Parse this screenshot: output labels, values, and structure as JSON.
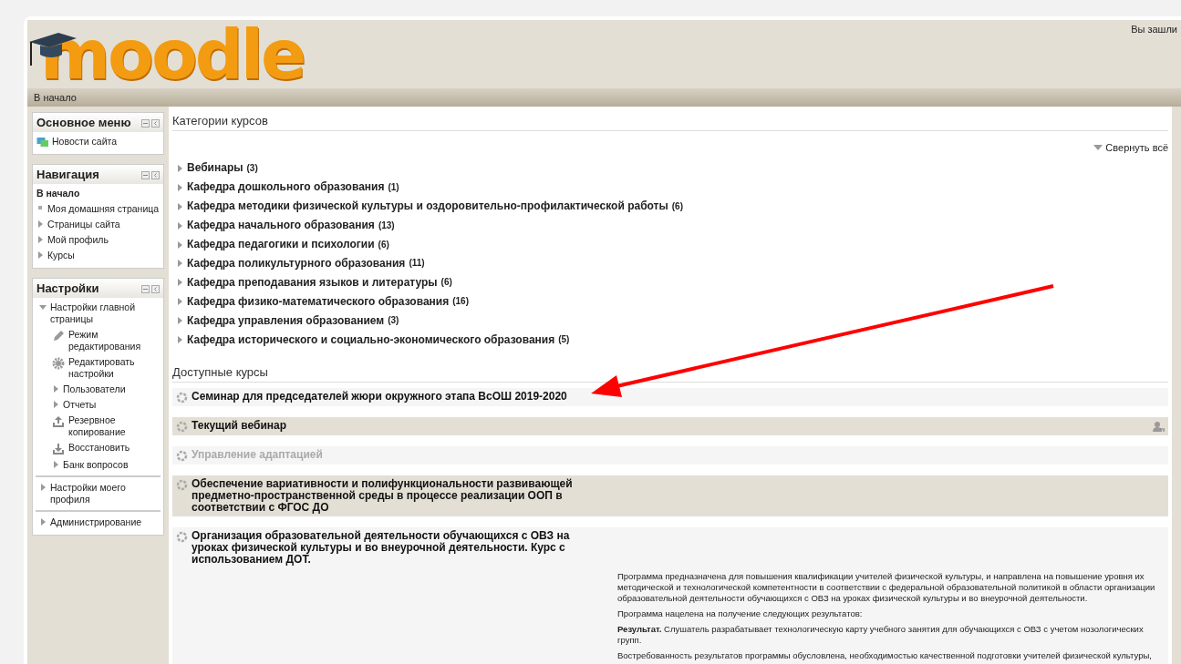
{
  "header": {
    "logo_text": "moodle",
    "login_info": "Вы зашли",
    "breadcrumb": "В начало"
  },
  "sidebar": [
    {
      "title": "Основное меню",
      "items": [
        {
          "label": "Новости сайта",
          "kind": "news"
        }
      ]
    },
    {
      "title": "Навигация",
      "items": [
        {
          "label": "В начало",
          "kind": "heading"
        },
        {
          "label": "Моя домашняя страница",
          "kind": "bullet"
        },
        {
          "label": "Страницы сайта",
          "kind": "branch",
          "expanded": false
        },
        {
          "label": "Мой профиль",
          "kind": "branch",
          "expanded": false
        },
        {
          "label": "Курсы",
          "kind": "branch",
          "expanded": false
        }
      ]
    },
    {
      "title": "Настройки",
      "items": [
        {
          "label": "Настройки главной страницы",
          "kind": "branch",
          "expanded": true,
          "children": [
            {
              "label": "Режим редактирования",
              "kind": "pencil"
            },
            {
              "label": "Редактировать настройки",
              "kind": "gear"
            },
            {
              "label": "Пользователи",
              "kind": "branch",
              "expanded": false
            },
            {
              "label": "Отчеты",
              "kind": "branch",
              "expanded": false
            },
            {
              "label": "Резервное копирование",
              "kind": "upload"
            },
            {
              "label": "Восстановить",
              "kind": "download"
            },
            {
              "label": "Банк вопросов",
              "kind": "branch",
              "expanded": false
            }
          ]
        },
        {
          "label": "Настройки моего профиля",
          "kind": "branch",
          "expanded": false,
          "divider": true
        },
        {
          "label": "Администрирование",
          "kind": "branch",
          "expanded": false,
          "divider": true
        }
      ]
    }
  ],
  "categories": {
    "heading": "Категории курсов",
    "collapse_all": "Свернуть всё",
    "items": [
      {
        "name": "Вебинары",
        "count": "(3)"
      },
      {
        "name": "Кафедра дошкольного образования",
        "count": "(1)"
      },
      {
        "name": "Кафедра методики физической культуры и оздоровительно-профилактической работы",
        "count": "(6)"
      },
      {
        "name": "Кафедра начального образования",
        "count": "(13)"
      },
      {
        "name": "Кафедра педагогики и психологии",
        "count": "(6)"
      },
      {
        "name": "Кафедра поликультурного образования",
        "count": "(11)"
      },
      {
        "name": "Кафедра преподавания языков и литературы",
        "count": "(6)"
      },
      {
        "name": "Кафедра физико-математического образования",
        "count": "(16)"
      },
      {
        "name": "Кафедра управления образованием",
        "count": "(3)"
      },
      {
        "name": "Кафедра исторического и социально-экономического образования",
        "count": "(5)"
      }
    ]
  },
  "courses": {
    "heading": "Доступные курсы",
    "items": [
      {
        "name": "Семинар для председателей жюри окружного этапа ВсОШ 2019-2020",
        "dimmed": false,
        "guest_access": false
      },
      {
        "name": "Текущий вебинар",
        "dimmed": false,
        "guest_access": true
      },
      {
        "name": "Управление адаптацией",
        "dimmed": true,
        "guest_access": false
      },
      {
        "name": "Обеспечение вариативности и полифункциональности развивающей предметно-пространственной среды в процессе реализации ООП в соответствии с ФГОС ДО",
        "dimmed": false,
        "guest_access": false
      },
      {
        "name": "Организация образовательной деятельности обучающихся с ОВЗ на уроках физической культуры и во внеурочной деятельности. Курс с использованием ДОТ.",
        "dimmed": false,
        "guest_access": false,
        "summary": [
          "Программа предназначена для повышения квалификации учителей физической культуры, и направлена на повышение уровня их методической и технологической компетентности в соответствии с федеральной образовательной политикой в области организации образовательной деятельности обучающихся с ОВЗ на уроках физической культуры и во внеурочной деятельности.",
          "Программа нацелена на получение следующих результатов:",
          "**Результат.** Слушатель разрабатывает технологическую карту учебного занятия для обучающихся с ОВЗ с учетом нозологических групп.",
          "Востребованность результатов программы обусловлена, необходимостью качественной подготовки учителей физической культуры,"
        ]
      }
    ]
  }
}
